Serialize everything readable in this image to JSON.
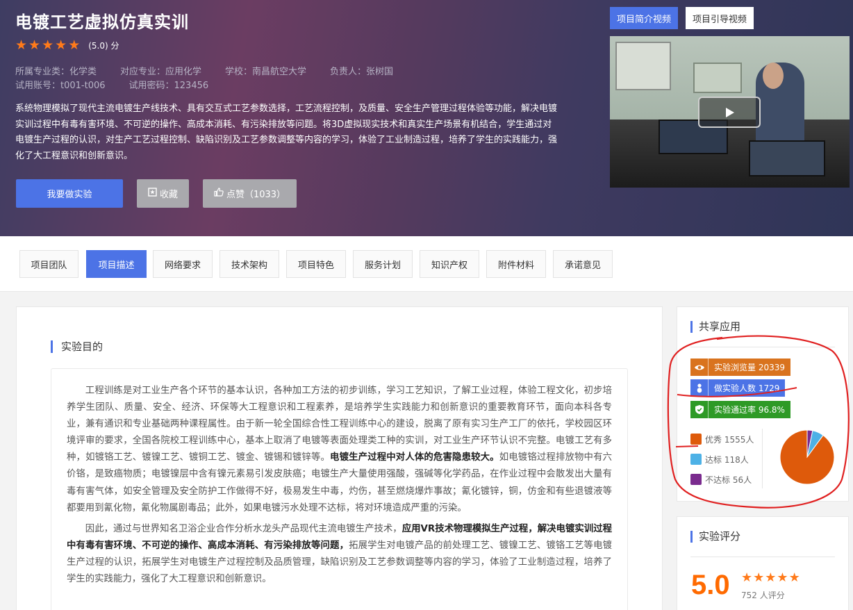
{
  "hero": {
    "title": "电镀工艺虚拟仿真实训",
    "rating": "(5.0) 分",
    "star": "★",
    "meta": {
      "major_category": "所属专业类：化学类",
      "major": "对应专业：应用化学",
      "school": "学校：南昌航空大学",
      "owner": "负责人：张树国",
      "account": "试用账号：t001-t006",
      "password": "试用密码：123456"
    },
    "description": "系统物理模拟了现代主流电镀生产线技术、具有交互式工艺参数选择，工艺流程控制，及质量、安全生产管理过程体验等功能，解决电镀实训过程中有毒有害环境、不可逆的操作、高成本消耗、有污染排放等问题。将3D虚拟现实技术和真实生产场景有机结合，学生通过对电镀生产过程的认识，对生产工艺过程控制、缺陷识别及工艺参数调整等内容的学习，体验了工业制造过程，培养了学生的实践能力，强化了大工程意识和创新意识。",
    "buttons": {
      "do_experiment": "我要做实验",
      "favorite": "收藏",
      "like": "点赞（1033）"
    },
    "video_tabs": [
      "项目简介视频",
      "项目引导视频"
    ]
  },
  "tabs": [
    "项目团队",
    "项目描述",
    "网络要求",
    "技术架构",
    "项目特色",
    "服务计划",
    "知识产权",
    "附件材料",
    "承诺意见"
  ],
  "active_tab": "项目描述",
  "main": {
    "section_title": "实验目的",
    "p1_a": "工程训练是对工业生产各个环节的基本认识，各种加工方法的初步训练，学习工艺知识，了解工业过程，体验工程文化，初步培养学生团队、质量、安全、经济、环保等大工程意识和工程素养，是培养学生实践能力和创新意识的重要教育环节，面向本科各专业，兼有通识和专业基础两种课程属性。由于新一轮全国综合性工程训练中心的建设，脱离了原有实习生产工厂的依托，学校园区环境评审的要求，全国各院校工程训练中心，基本上取消了电镀等表面处理类工种的实训，对工业生产环节认识不完整。电镀工艺有多种，如镀铬工艺、镀镍工艺、镀铜工艺、镀金、镀锡和镀锌等。",
    "p1_bold": "电镀生产过程中对人体的危害隐患较大。",
    "p1_b": "如电镀铬过程排放物中有六价铬，是致癌物质；电镀镍层中含有镍元素易引发皮肤癌；电镀生产大量使用强酸，强碱等化学药品，在作业过程中会散发出大量有毒有害气体，如安全管理及安全防护工作做得不好，极易发生中毒，灼伤，甚至燃烧爆炸事故；氰化镀锌，铜，仿金和有些退镀液等都要用到氰化物，氰化物属剧毒品；此外，如果电镀污水处理不达标，将对环境造成严重的污染。",
    "p2_a": "因此，通过与世界知名卫浴企业合作分析水龙头产品现代主流电镀生产技术，",
    "p2_bold": "应用VR技术物理模拟生产过程，解决电镀实训过程中有毒有害环境、不可逆的操作、高成本消耗、有污染排放等问题，",
    "p2_b": "拓展学生对电镀产品的前处理工艺、镀镍工艺、镀铬工艺等电镀生产过程的认识，拓展学生对电镀生产过程控制及品质管理，缺陷识别及工艺参数调整等内容的学习，体验了工业制造过程，培养了学生的实践能力，强化了大工程意识和创新意识。"
  },
  "sidebar": {
    "share": {
      "title": "共享应用",
      "views": "实验浏览量 20339",
      "participants": "做实验人数 1729",
      "pass_rate": "实验通过率 96.8%",
      "legend": [
        {
          "label": "优秀 1555人",
          "color": "#de5a0b"
        },
        {
          "label": "达标 118人",
          "color": "#4db1e6"
        },
        {
          "label": "不达标 56人",
          "color": "#7a2b8e"
        }
      ]
    },
    "rating": {
      "title": "实验评分",
      "score": "5.0",
      "count": "752 人评分"
    }
  },
  "chart_data": {
    "type": "pie",
    "categories": [
      "优秀",
      "达标",
      "不达标"
    ],
    "values": [
      1555,
      118,
      56
    ],
    "colors": [
      "#de5a0b",
      "#4db1e6",
      "#7a2b8e"
    ]
  },
  "annotation": {
    "color": "#e02020"
  }
}
